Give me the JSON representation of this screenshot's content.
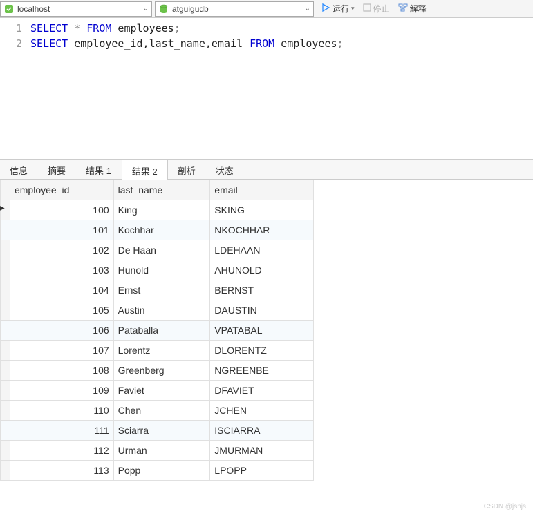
{
  "toolbar": {
    "connection": {
      "label": "localhost"
    },
    "database": {
      "label": "atguigudb"
    },
    "run": "运行",
    "stop": "停止",
    "explain": "解释"
  },
  "editor": {
    "lines": [
      {
        "num": "1"
      },
      {
        "num": "2"
      }
    ],
    "kw_select": "SELECT",
    "kw_from": "FROM",
    "star": " * ",
    "tbl": " employees",
    "semi": ";",
    "cols": " employee_id,last_name,email"
  },
  "tabs": {
    "info": "信息",
    "summary": "摘要",
    "result1": "结果 1",
    "result2": "结果 2",
    "profile": "剖析",
    "status": "状态"
  },
  "grid": {
    "headers": {
      "id": "employee_id",
      "ln": "last_name",
      "em": "email"
    },
    "rows": [
      {
        "id": "100",
        "ln": "King",
        "em": "SKING"
      },
      {
        "id": "101",
        "ln": "Kochhar",
        "em": "NKOCHHAR"
      },
      {
        "id": "102",
        "ln": "De Haan",
        "em": "LDEHAAN"
      },
      {
        "id": "103",
        "ln": "Hunold",
        "em": "AHUNOLD"
      },
      {
        "id": "104",
        "ln": "Ernst",
        "em": "BERNST"
      },
      {
        "id": "105",
        "ln": "Austin",
        "em": "DAUSTIN"
      },
      {
        "id": "106",
        "ln": "Pataballa",
        "em": "VPATABAL"
      },
      {
        "id": "107",
        "ln": "Lorentz",
        "em": "DLORENTZ"
      },
      {
        "id": "108",
        "ln": "Greenberg",
        "em": "NGREENBE"
      },
      {
        "id": "109",
        "ln": "Faviet",
        "em": "DFAVIET"
      },
      {
        "id": "110",
        "ln": "Chen",
        "em": "JCHEN"
      },
      {
        "id": "111",
        "ln": "Sciarra",
        "em": "ISCIARRA"
      },
      {
        "id": "112",
        "ln": "Urman",
        "em": "JMURMAN"
      },
      {
        "id": "113",
        "ln": "Popp",
        "em": "LPOPP"
      }
    ]
  },
  "watermark": "CSDN @jsnjs"
}
